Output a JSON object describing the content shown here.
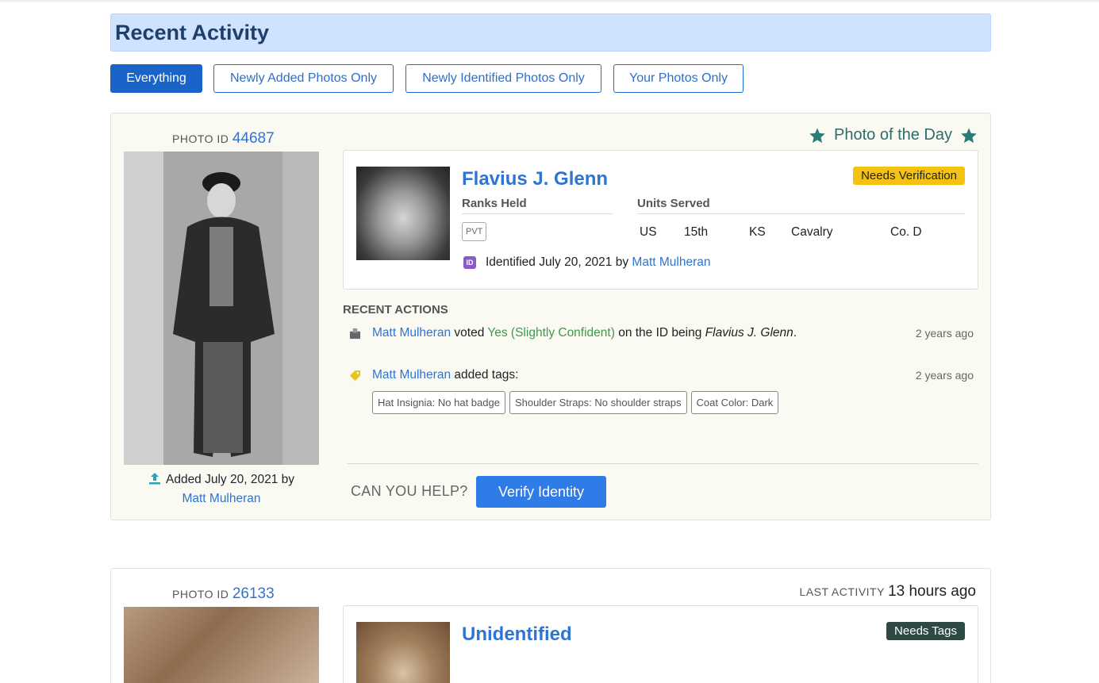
{
  "header": {
    "title": "Recent Activity"
  },
  "filters": [
    {
      "label": "Everything",
      "active": true
    },
    {
      "label": "Newly Added Photos Only",
      "active": false
    },
    {
      "label": "Newly Identified Photos Only",
      "active": false
    },
    {
      "label": "Your Photos Only",
      "active": false
    }
  ],
  "card1": {
    "photo_id_label": "PHOTO ID",
    "photo_id": "44687",
    "featured_label": "Photo of the Day",
    "soldier_name": "Flavius J. Glenn",
    "status_badge": "Needs Verification",
    "ranks_label": "Ranks Held",
    "rank": "PVT",
    "units_label": "Units Served",
    "unit": {
      "country": "US",
      "number": "15th",
      "state": "KS",
      "branch": "Cavalry",
      "company": "Co. D"
    },
    "identified_prefix": "Identified July 20, 2021 by",
    "identified_by": "Matt Mulheran",
    "recent_actions_label": "RECENT ACTIONS",
    "actions": [
      {
        "user": "Matt Mulheran",
        "verb": "voted",
        "vote": "Yes (Slightly Confident)",
        "middle": "on the ID being",
        "subject": "Flavius J. Glenn",
        "end": ".",
        "time": "2 years ago"
      },
      {
        "user": "Matt Mulheran",
        "verb": "added tags:",
        "time": "2 years ago",
        "tags": [
          "Hat Insignia: No hat badge",
          "Shoulder Straps: No shoulder straps",
          "Coat Color: Dark"
        ]
      }
    ],
    "added_prefix": "Added July 20, 2021 by",
    "added_by": "Matt Mulheran",
    "can_you_help": "CAN YOU HELP?",
    "verify_button": "Verify Identity"
  },
  "card2": {
    "photo_id_label": "PHOTO ID",
    "photo_id": "26133",
    "last_activity_label": "LAST ACTIVITY",
    "last_activity_value": "13 hours ago",
    "soldier_name": "Unidentified",
    "status_badge": "Needs Tags"
  },
  "colors": {
    "accent": "#2f74d0",
    "header_bg": "#cfe2ff",
    "card_bg": "#fafaf3",
    "needs_verification": "#f5c211",
    "needs_tags": "#2f4944",
    "featured": "#2d6e6a"
  },
  "icons": [
    "star-icon",
    "upload-icon",
    "id-icon",
    "vote-icon",
    "tag-icon"
  ]
}
